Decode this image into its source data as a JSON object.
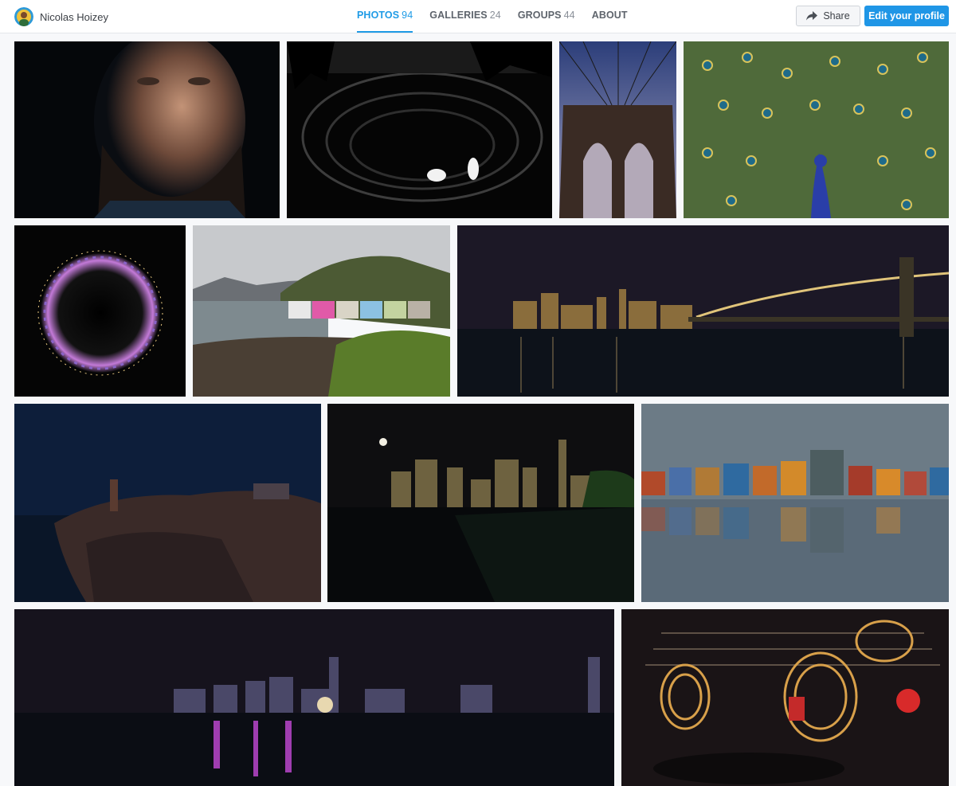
{
  "user": {
    "name": "Nicolas Hoizey",
    "avatar_icon": "avatar-icon"
  },
  "tabs": [
    {
      "label": "PHOTOS",
      "count": "94",
      "active": true
    },
    {
      "label": "GALLERIES",
      "count": "24",
      "active": false
    },
    {
      "label": "GROUPS",
      "count": "44",
      "active": false
    },
    {
      "label": "ABOUT",
      "count": "",
      "active": false
    }
  ],
  "actions": {
    "share_label": "Share",
    "share_icon": "share-arrow-icon",
    "edit_label": "Edit your profile"
  },
  "colors": {
    "accent": "#1f96e6",
    "background": "#f7f8fa"
  },
  "photos": [
    {
      "subject": "bearded-man-portrait"
    },
    {
      "subject": "swans-black-water"
    },
    {
      "subject": "brooklyn-bridge-arches"
    },
    {
      "subject": "peacock-feathers"
    },
    {
      "subject": "tiny-planet-night"
    },
    {
      "subject": "colorful-harbour-village"
    },
    {
      "subject": "manhattan-bridge-night"
    },
    {
      "subject": "lighthouse-rocks-blue-hour"
    },
    {
      "subject": "manhattan-moon-night"
    },
    {
      "subject": "colorful-houses-reflection"
    },
    {
      "subject": "hong-kong-skyline-night"
    },
    {
      "subject": "incense-coils-temple"
    }
  ]
}
